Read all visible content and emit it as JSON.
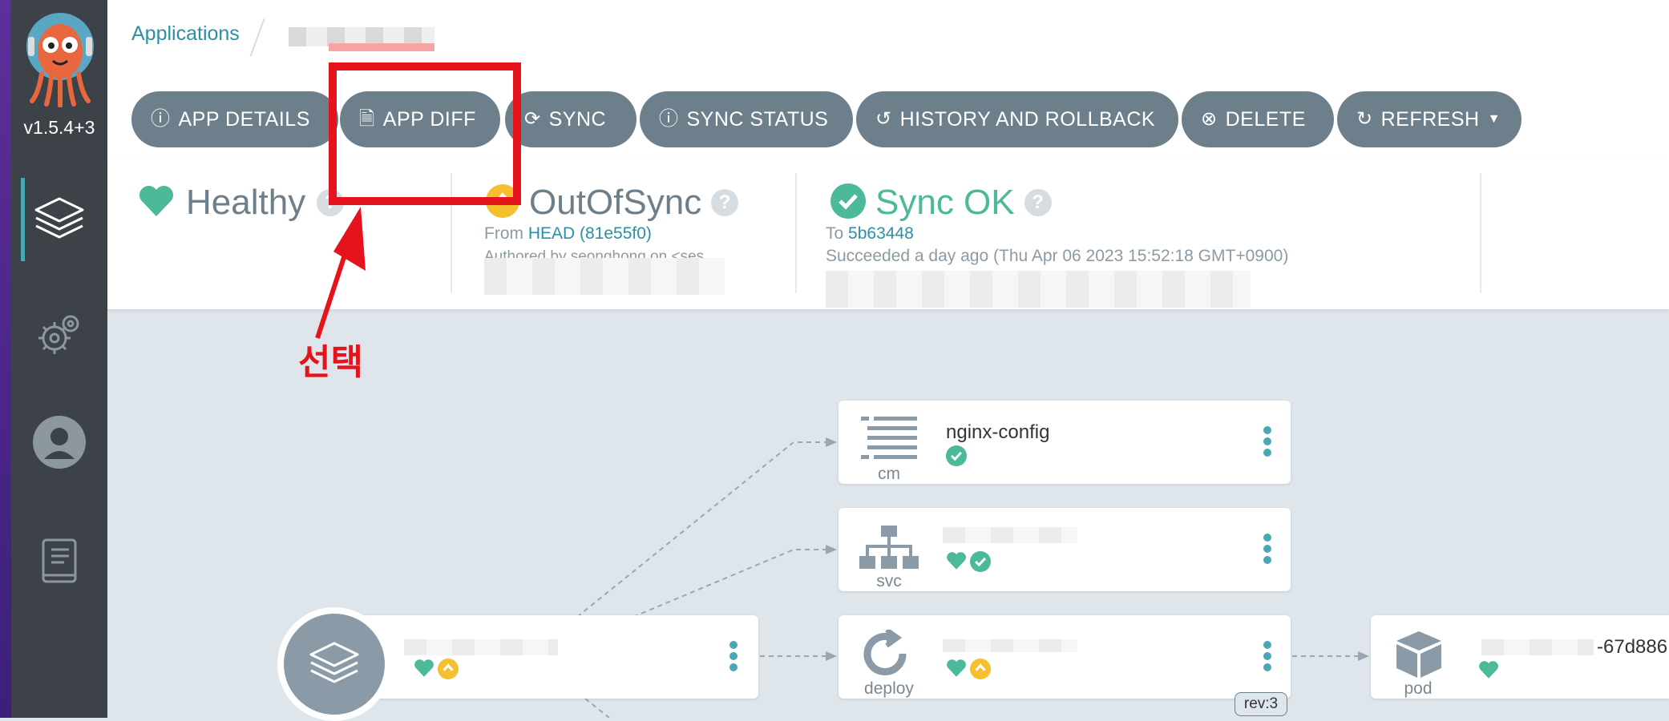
{
  "sidebar": {
    "version": "v1.5.4+3",
    "items": [
      "applications-icon",
      "settings-icon",
      "user-icon",
      "docs-icon"
    ]
  },
  "breadcrumb": {
    "applications": "Applications"
  },
  "toolbar": {
    "app_details": "APP DETAILS",
    "app_diff": "APP DIFF",
    "sync": "SYNC",
    "sync_status": "SYNC STATUS",
    "history": "HISTORY AND ROLLBACK",
    "delete": "DELETE",
    "refresh": "REFRESH"
  },
  "status": {
    "health": "Healthy",
    "sync_status": "OutOfSync",
    "from_label": "From",
    "from_ref": "HEAD (81e55f0)",
    "authored": "Authored by seonghong on <ses",
    "op_status": "Sync OK",
    "to_label": "To",
    "to_ref": "5b63448",
    "succeeded": "Succeeded a day ago (Thu Apr 06 2023 15:52:18 GMT+0900)"
  },
  "annotation": {
    "text": "선택"
  },
  "tree": {
    "nodes": [
      {
        "label": "nginx-config",
        "kind": "cm"
      },
      {
        "label": "",
        "kind": "svc"
      },
      {
        "label": "",
        "kind": "deploy",
        "revision": "rev:3"
      },
      {
        "label": "-67d886",
        "kind": "pod"
      }
    ]
  },
  "colors": {
    "sidebar": "#3c4247",
    "accent": "#4aa7b6",
    "healthy": "#4bb99a",
    "out_of_sync": "#f4c030",
    "annotation": "#e5131b",
    "button": "#6d7f8b"
  }
}
